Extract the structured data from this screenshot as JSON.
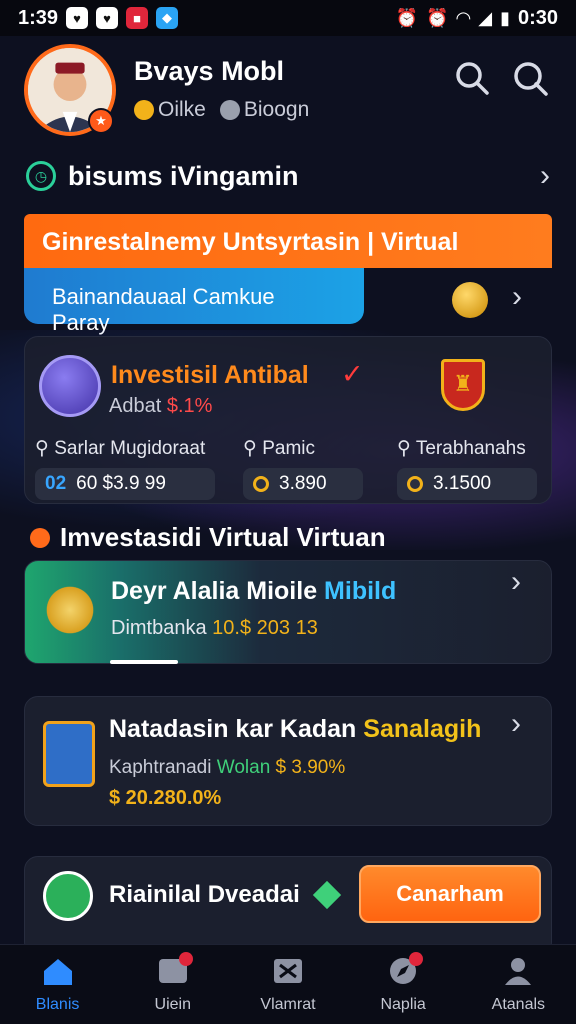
{
  "status_bar": {
    "time": "1:39",
    "right_clock": "0:30"
  },
  "profile": {
    "name": "Bvays Mobl",
    "stat_left": "Oilke",
    "stat_right": "Bioogn"
  },
  "section_main": {
    "title": "bisums iVingamin"
  },
  "banner": {
    "orange_text": "Ginrestalnemy Untsyrtasin | Virtual",
    "blue_pill_text": "Bainandauaal Camkue Paray"
  },
  "investment_card": {
    "title": "Investisil Antibal",
    "subtitle_prefix": "Adbat",
    "subtitle_value": "$.1%",
    "stats": [
      {
        "label": "Sarlar Mugidoraat",
        "value_prefix": "02",
        "value": "60 $3.9 99"
      },
      {
        "label": "Pamic",
        "value": "3.890"
      },
      {
        "label": "Terabhanahs",
        "value": "3.1500"
      }
    ]
  },
  "section_secondary": {
    "title": "Imvestasidi Virtual Virtuan"
  },
  "featured_card": {
    "title_main": "Deyr Alalia Mioile",
    "title_accent": "Mibild",
    "subtitle_prefix": "Dimtbanka",
    "subtitle_value": "10.$ 203 13"
  },
  "trade_card": {
    "title_main": "Natadasin kar Kadan",
    "title_accent": "Sanalagih",
    "sub_prefix": "Kaphtranadi",
    "sub_green": "Wolan",
    "sub_gold": "$ 3.90%",
    "amount": "$ 20.280.0%"
  },
  "bottom_card": {
    "title": "Riainilal Dveadai",
    "cta_label": "Canarham"
  },
  "bottom_nav": [
    {
      "label": "Blanis",
      "icon": "home-icon",
      "active": true
    },
    {
      "label": "Uiein",
      "icon": "chat-icon"
    },
    {
      "label": "Vlamrat",
      "icon": "wallet-icon"
    },
    {
      "label": "Naplia",
      "icon": "compass-icon"
    },
    {
      "label": "Atanals",
      "icon": "user-icon"
    }
  ],
  "colors": {
    "accent_orange": "#ff6a1a",
    "accent_blue": "#2f8cff",
    "background": "#0d1020",
    "card": "#1b1f2e"
  }
}
